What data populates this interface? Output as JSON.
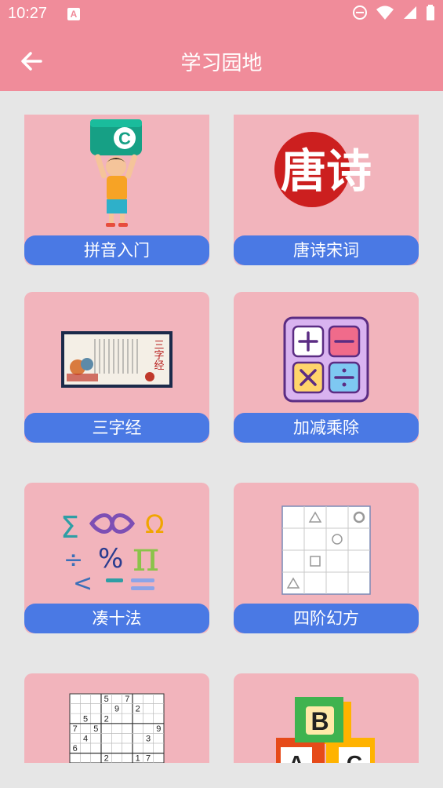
{
  "status_bar": {
    "time": "10:27",
    "app_icon": "A"
  },
  "app_bar": {
    "title": "学习园地"
  },
  "cards": [
    {
      "label": "拼音入门",
      "icon": "pinyin-icon",
      "letter": "C"
    },
    {
      "label": "唐诗宋词",
      "icon": "tang-poem-seal-icon",
      "seal_text": "唐诗"
    },
    {
      "label": "三字经",
      "icon": "three-character-classic-scroll-icon",
      "scroll_text": "三字经"
    },
    {
      "label": "加减乘除",
      "icon": "arithmetic-operators-icon"
    },
    {
      "label": "凑十法",
      "icon": "math-symbols-icon"
    },
    {
      "label": "四阶幻方",
      "icon": "magic-square-grid-icon"
    },
    {
      "label": "",
      "icon": "sudoku-icon"
    },
    {
      "label": "",
      "icon": "abc-blocks-icon",
      "block_letters": [
        "B",
        "A",
        "C"
      ]
    }
  ],
  "sudoku_digits": [
    [
      "",
      "",
      "",
      "5",
      "",
      "7",
      "",
      "",
      ""
    ],
    [
      "",
      "",
      "",
      "",
      "9",
      "",
      "2",
      "",
      ""
    ],
    [
      "",
      "5",
      "",
      "2",
      "",
      "",
      "",
      "",
      ""
    ],
    [
      "7",
      "",
      "5",
      "",
      "",
      "",
      "",
      "",
      "9"
    ],
    [
      "",
      "4",
      "",
      "",
      "",
      "",
      "",
      "3",
      ""
    ],
    [
      "6",
      "",
      "",
      "",
      "",
      "",
      "",
      "",
      ""
    ],
    [
      "",
      "",
      "",
      "2",
      "",
      "",
      "1",
      "7",
      ""
    ]
  ],
  "colors": {
    "header": "#f08c9a",
    "card": "#f2b4bc",
    "label": "#4a79e4",
    "background": "#e6e6e6"
  }
}
